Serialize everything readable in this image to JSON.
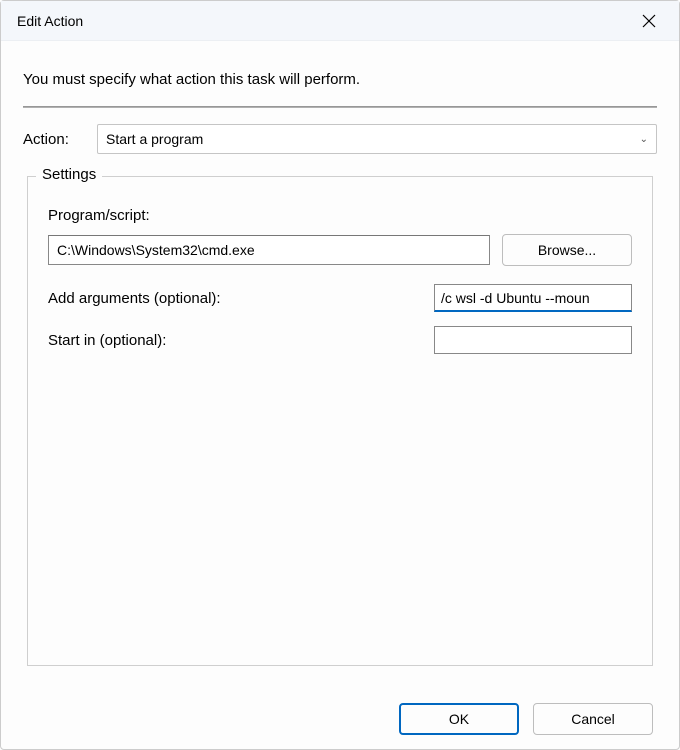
{
  "dialog": {
    "title": "Edit Action",
    "instruction": "You must specify what action this task will perform."
  },
  "action": {
    "label": "Action:",
    "selected": "Start a program"
  },
  "settings": {
    "legend": "Settings",
    "program": {
      "label": "Program/script:",
      "value": "C:\\Windows\\System32\\cmd.exe",
      "browse_label": "Browse..."
    },
    "arguments": {
      "label": "Add arguments (optional):",
      "value": "/c wsl -d Ubuntu --moun"
    },
    "startin": {
      "label": "Start in (optional):",
      "value": ""
    }
  },
  "footer": {
    "ok_label": "OK",
    "cancel_label": "Cancel"
  }
}
